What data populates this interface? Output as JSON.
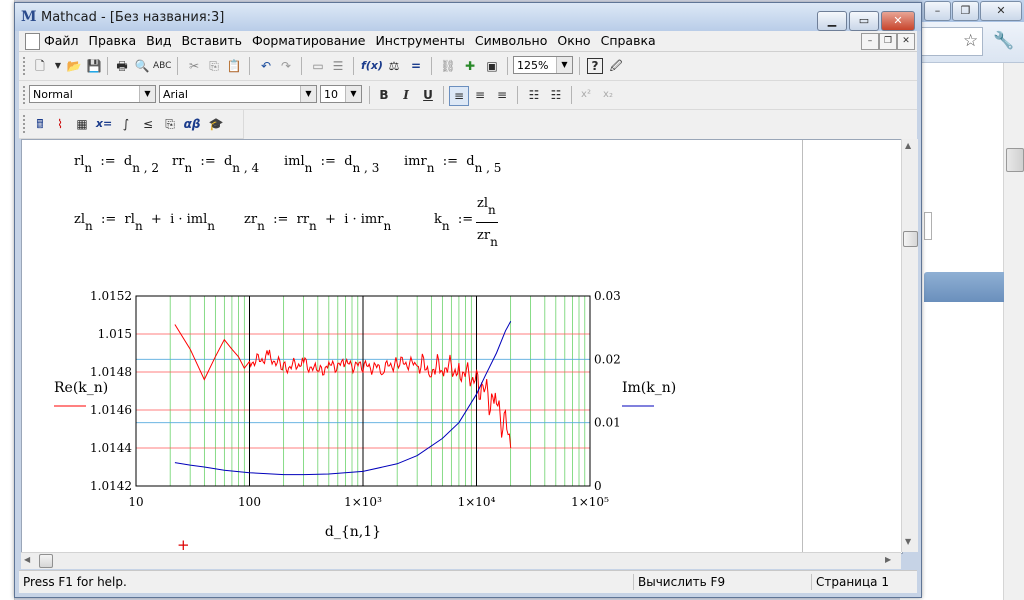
{
  "window": {
    "title": "Mathcad - [Без названия:3]",
    "app_icon": "M",
    "controls": [
      "minimize",
      "maximize",
      "close"
    ]
  },
  "menu": {
    "items": [
      "Файл",
      "Правка",
      "Вид",
      "Вставить",
      "Форматирование",
      "Инструменты",
      "Символьно",
      "Окно",
      "Справка"
    ]
  },
  "toolbar": {
    "zoom": "125%",
    "style": "Normal",
    "font": "Arial",
    "size": "10",
    "bold": "B",
    "italic": "I",
    "underline": "U"
  },
  "worksheet": {
    "defs1": [
      {
        "lhs": "rl",
        "sub": "n",
        "rhs": "d",
        "rsub": "n , 2"
      },
      {
        "lhs": "rr",
        "sub": "n",
        "rhs": "d",
        "rsub": "n , 4"
      },
      {
        "lhs": "iml",
        "sub": "n",
        "rhs": "d",
        "rsub": "n , 3"
      },
      {
        "lhs": "imr",
        "sub": "n",
        "rhs": "d",
        "rsub": "n , 5"
      }
    ],
    "assign_op": ":=",
    "zl_def": "zl_n := rl_n + i · iml_n",
    "zr_def": "zr_n := rr_n + i · imr_n",
    "k_def": "k_n := zl_n / zr_n"
  },
  "chart_data": {
    "type": "line",
    "x_scale": "log",
    "xlim": [
      10,
      100000
    ],
    "x_ticks": [
      "10",
      "100",
      "1×10³",
      "1×10⁴",
      "1×10⁵"
    ],
    "xlabel": "d_{n,1}",
    "y_left": {
      "label": "Re(k_n)",
      "ylim": [
        1.0142,
        1.0152
      ],
      "ticks": [
        "1.0152",
        "1.015",
        "1.0148",
        "1.0146",
        "1.0144",
        "1.0142"
      ]
    },
    "y_right": {
      "label": "Im(k_n)",
      "ylim": [
        0,
        0.03
      ],
      "ticks": [
        "0.03",
        "0.02",
        "0.01",
        "0"
      ]
    },
    "series": [
      {
        "name": "Re(k_n)",
        "color": "#ff0000",
        "axis": "left",
        "x": [
          22,
          30,
          40,
          50,
          60,
          70,
          80,
          90,
          100,
          150,
          200,
          300,
          400,
          500,
          700,
          1000,
          1500,
          2000,
          3000,
          4000,
          5000,
          7000,
          10000,
          12000,
          15000,
          18000,
          20000
        ],
        "y": [
          1.01505,
          1.01492,
          1.01476,
          1.01488,
          1.01497,
          1.01492,
          1.01488,
          1.01482,
          1.01485,
          1.01488,
          1.01482,
          1.01485,
          1.0148,
          1.01483,
          1.01484,
          1.01483,
          1.01482,
          1.01485,
          1.01484,
          1.01482,
          1.01483,
          1.01481,
          1.01476,
          1.0147,
          1.01462,
          1.01452,
          1.0144
        ]
      },
      {
        "name": "Im(k_n)",
        "color": "#0000bb",
        "axis": "right",
        "x": [
          22,
          30,
          40,
          60,
          100,
          200,
          300,
          500,
          1000,
          2000,
          3000,
          5000,
          7000,
          10000,
          12000,
          15000,
          18000,
          20000
        ],
        "y": [
          0.0037,
          0.0033,
          0.003,
          0.0025,
          0.0021,
          0.0018,
          0.0018,
          0.0019,
          0.0023,
          0.0035,
          0.0048,
          0.0075,
          0.01,
          0.0145,
          0.0175,
          0.021,
          0.0245,
          0.026
        ]
      }
    ],
    "grid": true
  },
  "status": {
    "help": "Press F1 for help.",
    "calc": "Вычислить F9",
    "page": "Страница 1"
  },
  "colors": {
    "re_series": "#ff0000",
    "im_series": "#0000bb",
    "major_grid": "#000000",
    "minor_grid_x": "#55cc55",
    "hgrid_left": "#ff5555",
    "hgrid_right": "#55aadd"
  }
}
